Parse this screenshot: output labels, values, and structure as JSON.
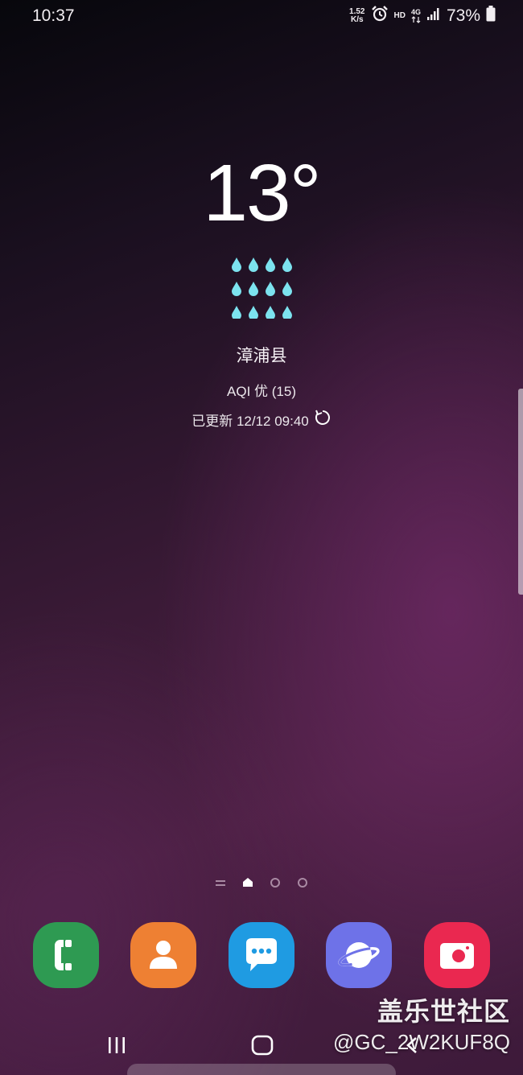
{
  "status_bar": {
    "time": "10:37",
    "net_speed_value": "1.52",
    "net_speed_unit": "K/s",
    "hd_label": "HD",
    "network_type": "4G",
    "battery": "73%"
  },
  "weather": {
    "temperature": "13°",
    "condition_icon": "rain-icon",
    "location": "漳浦县",
    "aqi": "AQI 优 (15)",
    "updated": "已更新 12/12 09:40"
  },
  "dock": {
    "apps": [
      {
        "icon": "phone-icon",
        "color": "#2e9a52"
      },
      {
        "icon": "contacts-icon",
        "color": "#ee8033"
      },
      {
        "icon": "messages-icon",
        "color": "#1f9be2"
      },
      {
        "icon": "internet-icon",
        "color": "#6e72e8"
      },
      {
        "icon": "camera-icon",
        "color": "#ea2850"
      }
    ]
  },
  "watermark": {
    "title": "盖乐世社区",
    "user": "@GC_2W2KUF8Q"
  },
  "colors": {
    "rain_drop": "#7ce3ef"
  }
}
